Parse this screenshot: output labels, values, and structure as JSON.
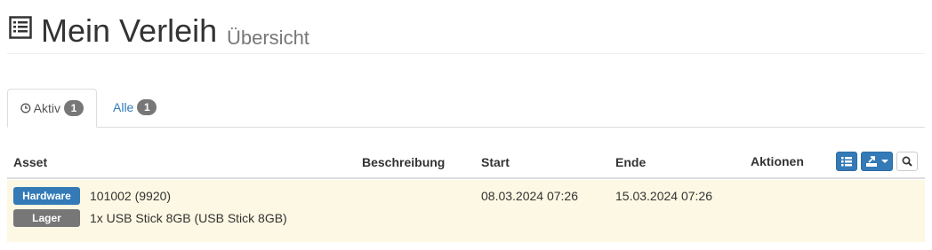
{
  "page": {
    "title": "Mein Verleih",
    "subtitle": "Übersicht",
    "title_icon": "list-alt-icon"
  },
  "tabs": [
    {
      "label": "Aktiv",
      "count": "1",
      "icon": "clock-icon",
      "active": true
    },
    {
      "label": "Alle",
      "count": "1",
      "active": false
    }
  ],
  "table": {
    "columns": [
      "Asset",
      "Beschreibung",
      "Start",
      "Ende",
      "Aktionen"
    ],
    "toolbar": [
      {
        "icon": "list-icon",
        "name": "columns-button"
      },
      {
        "icon": "export-icon",
        "name": "export-dropdown-button"
      },
      {
        "icon": "search-icon",
        "name": "search-button"
      }
    ],
    "rows": [
      {
        "labels": [
          "Hardware",
          "Lager"
        ],
        "asset_id": "101002 (9920)",
        "asset_name": "1x USB Stick 8GB (USB Stick 8GB)",
        "beschreibung": "",
        "start": "08.03.2024 07:26",
        "ende": "15.03.2024 07:26",
        "aktionen": ""
      }
    ]
  },
  "colors": {
    "primary": "#337ab7",
    "default_label": "#777777",
    "row_highlight": "#fcf8e3",
    "border": "#dddddd"
  }
}
